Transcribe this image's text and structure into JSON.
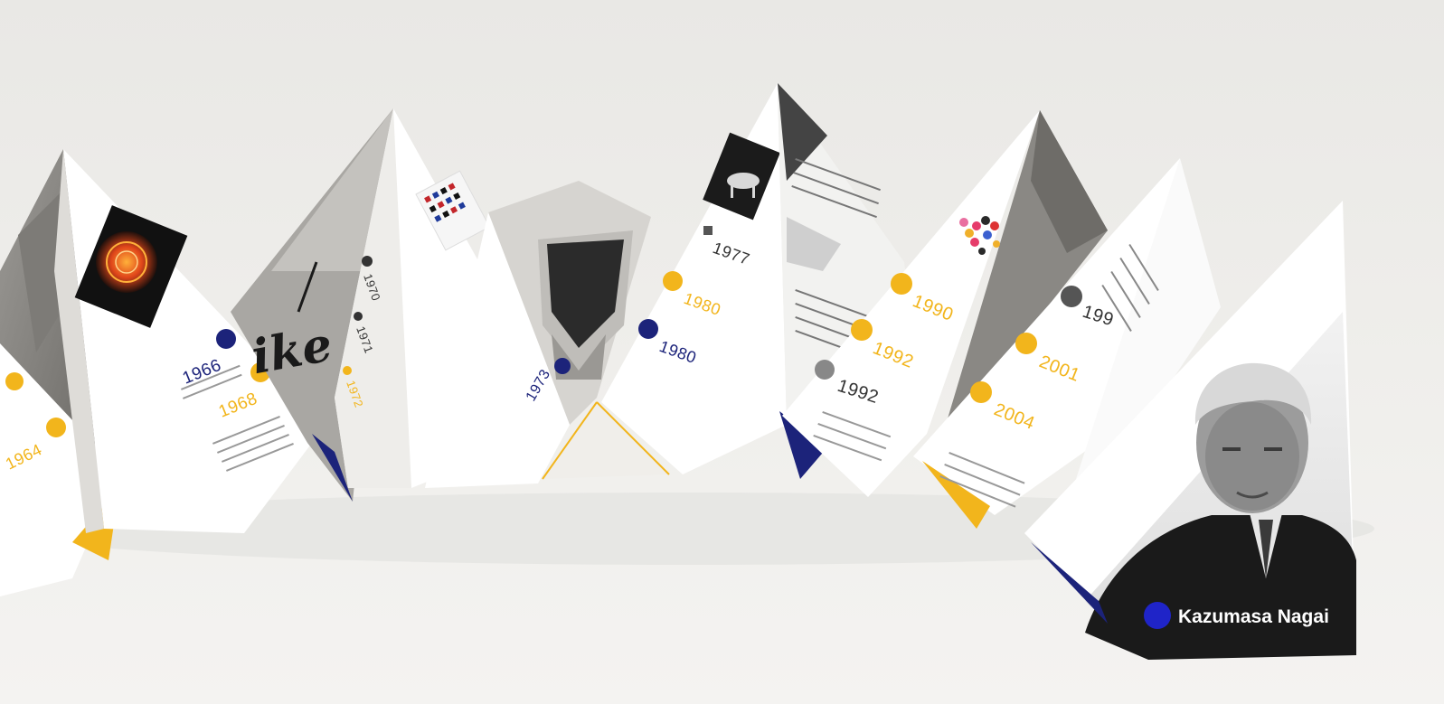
{
  "timeline": {
    "entries": [
      {
        "year": "1964",
        "dot": "yellow"
      },
      {
        "year": "1966",
        "dot": "blue"
      },
      {
        "year": "1968",
        "dot": "yellow"
      },
      {
        "year": "1970",
        "dot": "dark"
      },
      {
        "year": "1971",
        "dot": "dark"
      },
      {
        "year": "1972",
        "dot": "yellow"
      },
      {
        "year": "1973",
        "dot": "blue"
      },
      {
        "year": "1977",
        "dot": "dark"
      },
      {
        "year": "1980",
        "dot": "yellow"
      },
      {
        "year": "1980",
        "dot": "blue"
      },
      {
        "year": "1990",
        "dot": "yellow"
      },
      {
        "year": "1992",
        "dot": "yellow"
      },
      {
        "year": "1992",
        "dot": "dark"
      },
      {
        "year": "199",
        "dot": "dark"
      },
      {
        "year": "2001",
        "dot": "yellow"
      },
      {
        "year": "2004",
        "dot": "yellow"
      }
    ]
  },
  "cover": {
    "name": "Kazumasa Nagai"
  },
  "colors": {
    "background": "#ecebe8",
    "paper": "#ffffff",
    "accent_yellow": "#f2b51c",
    "accent_blue": "#1f24c8",
    "navy": "#1c237a",
    "text_dark": "#2a2a2a",
    "photo_dark": "#1a1a1a"
  }
}
